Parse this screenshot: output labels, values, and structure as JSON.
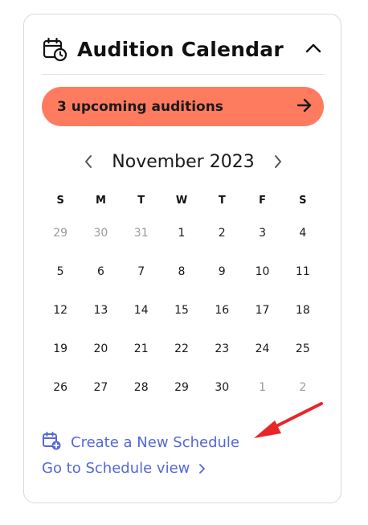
{
  "header": {
    "title": "Audition Calendar"
  },
  "banner": {
    "label": "3 upcoming auditions"
  },
  "calendar": {
    "month_label": "November 2023",
    "weekdays": [
      "S",
      "M",
      "T",
      "W",
      "T",
      "F",
      "S"
    ],
    "weeks": [
      [
        "29",
        "30",
        "31",
        "1",
        "2",
        "3",
        "4"
      ],
      [
        "5",
        "6",
        "7",
        "8",
        "9",
        "10",
        "11"
      ],
      [
        "12",
        "13",
        "14",
        "15",
        "16",
        "17",
        "18"
      ],
      [
        "19",
        "20",
        "21",
        "22",
        "23",
        "24",
        "25"
      ],
      [
        "26",
        "27",
        "28",
        "29",
        "30",
        "1",
        "2"
      ]
    ]
  },
  "links": {
    "create_schedule": "Create a New Schedule",
    "schedule_view": "Go to Schedule view"
  },
  "colors": {
    "banner": "#ff7b5f",
    "link": "#5468d8",
    "annotation_arrow": "#e8262a"
  },
  "icons": {
    "header": "calendar-clock-icon",
    "collapse": "chevron-up-icon",
    "banner": "arrow-right-icon",
    "prev_month": "chevron-left-icon",
    "next_month": "chevron-right-icon",
    "create": "calendar-plus-icon",
    "schedule_view": "chevron-right-icon"
  }
}
